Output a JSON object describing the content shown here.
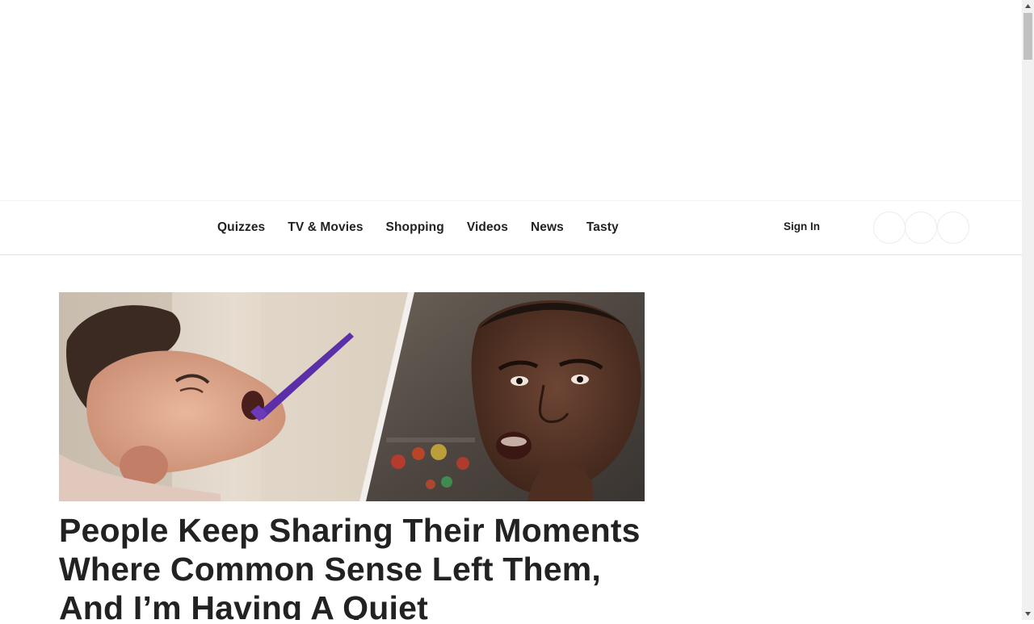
{
  "nav": {
    "items": [
      {
        "label": "Quizzes"
      },
      {
        "label": "TV & Movies"
      },
      {
        "label": "Shopping"
      },
      {
        "label": "Videos"
      },
      {
        "label": "News"
      },
      {
        "label": "Tasty"
      }
    ],
    "sign_in_label": "Sign In"
  },
  "article": {
    "hero_image_icon": "two-person-reaction-image",
    "headline": "People Keep Sharing Their Moments Where Common Sense Left Them, And I’m Having A Quiet"
  },
  "colors": {
    "text": "#222222",
    "nav_border": "#e6e6e6",
    "scroll_track": "#f1f1f1",
    "scroll_thumb": "#c1c1c1"
  }
}
